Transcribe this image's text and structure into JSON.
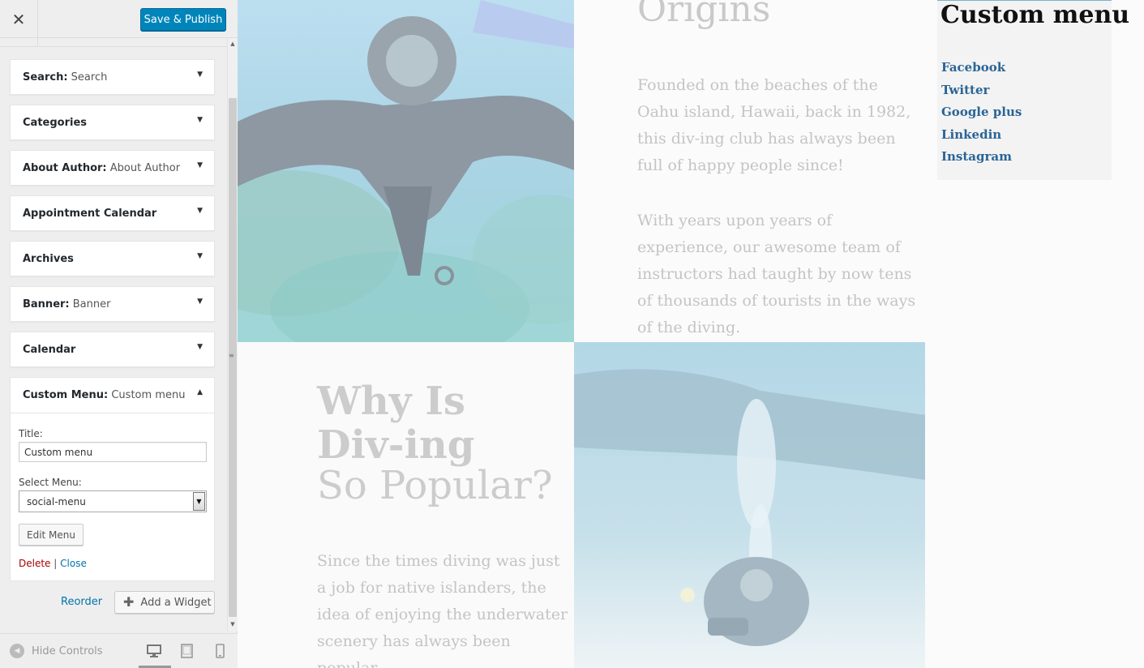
{
  "header": {
    "close_symbol": "✕",
    "save_label": "Save & Publish"
  },
  "widgets": [
    {
      "name": "Search:",
      "subtitle": " Search"
    },
    {
      "name": "Categories",
      "subtitle": ""
    },
    {
      "name": "About Author:",
      "subtitle": " About Author"
    },
    {
      "name": "Appointment Calendar",
      "subtitle": ""
    },
    {
      "name": "Archives",
      "subtitle": ""
    },
    {
      "name": "Banner:",
      "subtitle": " Banner"
    },
    {
      "name": "Calendar",
      "subtitle": ""
    }
  ],
  "expanded_widget": {
    "name": "Custom Menu:",
    "subtitle": " Custom menu",
    "title_label": "Title:",
    "title_value": "Custom menu",
    "select_label": "Select Menu:",
    "select_value": "social-menu",
    "edit_menu_label": "Edit Menu",
    "delete_label": "Delete",
    "separator": "|",
    "close_label": "Close"
  },
  "actions": {
    "reorder_label": "Reorder",
    "add_widget_label": "Add a Widget"
  },
  "footer": {
    "hide_controls_label": "Hide Controls",
    "active_device": "desktop"
  },
  "preview": {
    "origins_title": "Origins",
    "origins_p1": "Founded on the beaches of the Oahu island, Hawaii, back in 1982, this div-ing club has always been full of happy people since!",
    "origins_p2": "With years upon years of experience, our awesome team of instructors had taught by now tens of thousands of tourists in the ways of the diving.",
    "why_title": "Why Is Div-ing",
    "why_subtitle": "So Popular?",
    "why_p": "Since the times diving was just a job for native islanders, the idea of enjoying the underwater scenery has always been popular."
  },
  "custom_menu": {
    "title": "Custom menu",
    "links": [
      "Facebook",
      "Twitter",
      "Google plus",
      "Linkedin",
      "Instagram"
    ]
  },
  "colors": {
    "primary_button": "#0085ba",
    "link": "#0073aa",
    "delete": "#aa0000",
    "menu_link": "#2a6496"
  }
}
